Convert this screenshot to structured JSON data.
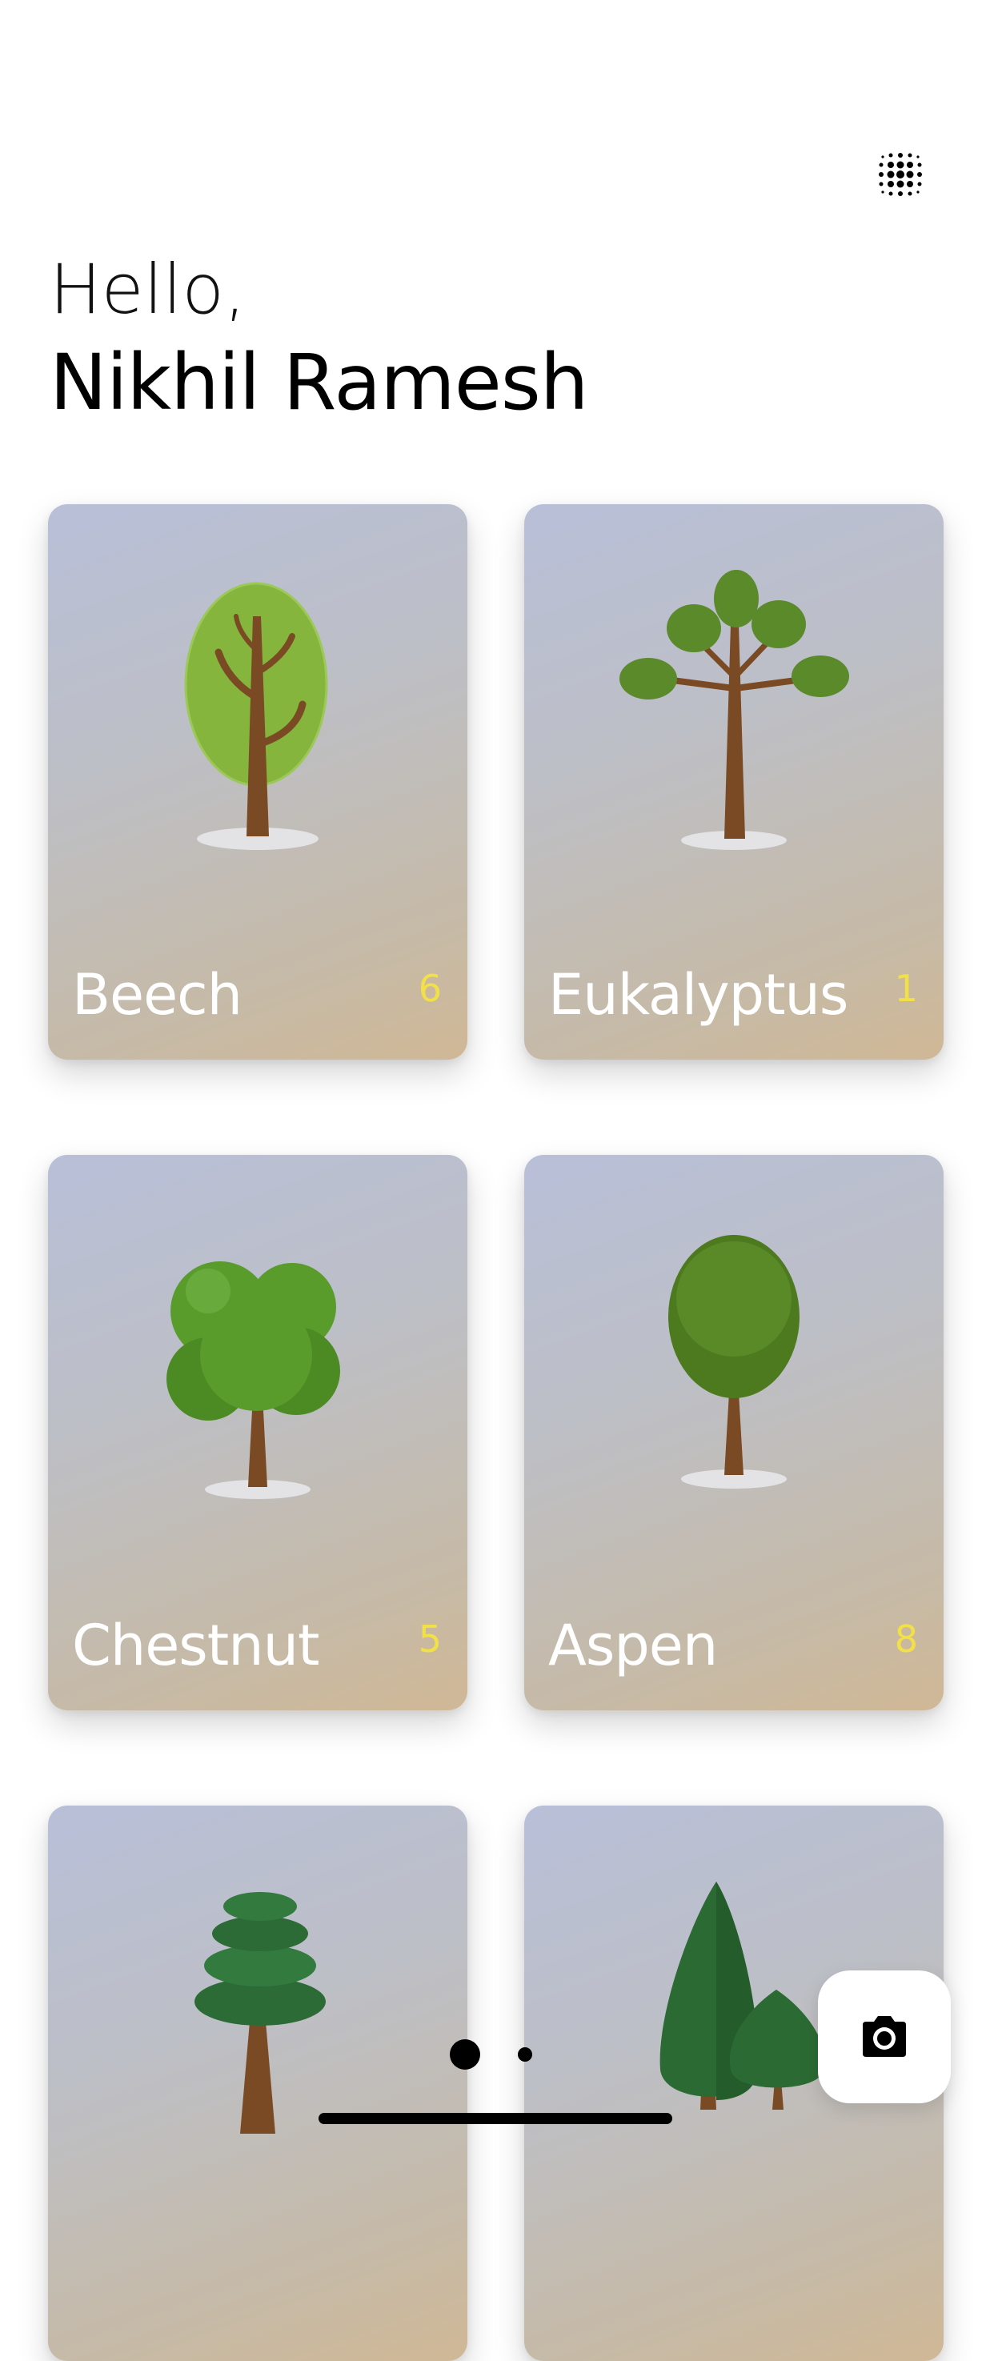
{
  "header": {
    "menu_icon": "dots-grid-icon",
    "greeting": "Hello,",
    "user_name": "Nikhil Ramesh"
  },
  "cards": [
    {
      "label": "Beech",
      "count": "6",
      "icon": "oval-tree-icon"
    },
    {
      "label": "Eukalyptus",
      "count": "1",
      "icon": "branch-tree-icon"
    },
    {
      "label": "Chestnut",
      "count": "5",
      "icon": "bushy-tree-icon"
    },
    {
      "label": "Aspen",
      "count": "8",
      "icon": "round-tree-icon"
    },
    {
      "label": "",
      "count": "",
      "icon": "pine-tree-icon"
    },
    {
      "label": "",
      "count": "",
      "icon": "cypress-trees-icon"
    }
  ],
  "pager": {
    "pages": 2,
    "active": 1
  },
  "camera_icon": "camera-icon",
  "colors": {
    "count": "#f2e146",
    "card_label": "#ffffff"
  }
}
